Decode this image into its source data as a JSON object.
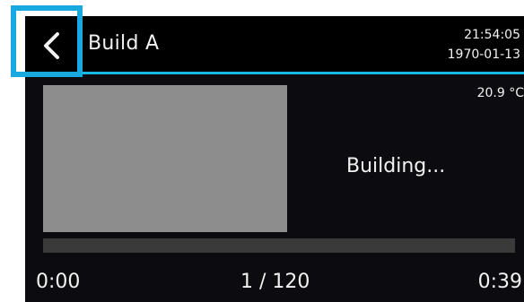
{
  "header": {
    "title": "Build A",
    "time": "21:54:05",
    "date": "1970-01-13",
    "back_icon": "chevron-left-icon"
  },
  "build": {
    "temperature": "20.9 °C",
    "status": "Building...",
    "time_elapsed": "0:00",
    "layer_count": "1 / 120",
    "time_remaining": "0:39",
    "progress_fraction": 0.0
  },
  "colors": {
    "accent": "#1ab6e8",
    "background": "#0b0b10",
    "preview": "#8d8d8d",
    "progress_track": "#3a3a3a",
    "highlight": "#1aa9de"
  }
}
